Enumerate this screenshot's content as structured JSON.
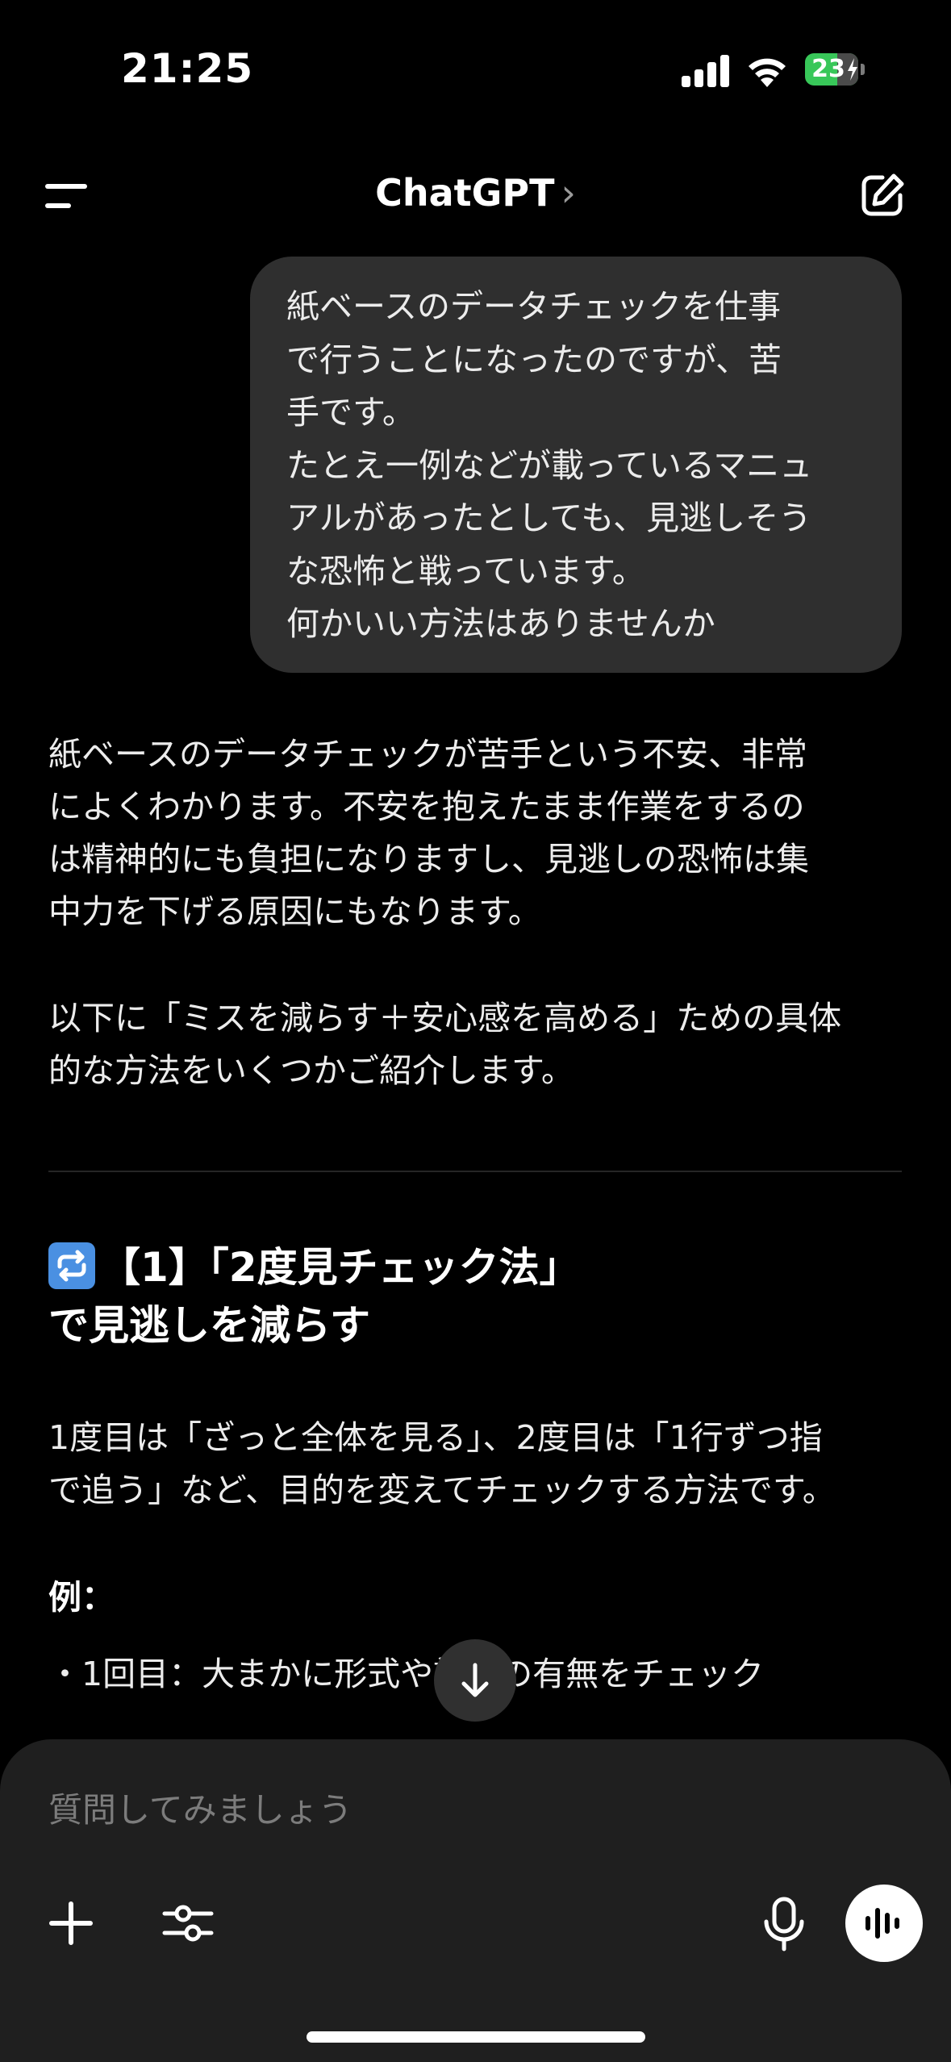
{
  "status_bar": {
    "time": "21:25",
    "battery_percent": "23"
  },
  "header": {
    "title": "ChatGPT",
    "chevron": "›"
  },
  "user_message": "紙ベースのデータチェックを仕事\nで行うことになったのですが、苦\n手です。\nたとえ一例などが載っているマニュ\nアルがあったとしても、見逃しそう\nな恐怖と戦っています。\n何かいい方法はありませんか",
  "assistant": {
    "para1": "紙ベースのデータチェックが苦手という不安、非常\nによくわかります。不安を抱えたまま作業をするの\nは精神的にも負担になりますし、見逃しの恐怖は集\n中力を下げる原因にもなります。",
    "para2": "以下に「ミスを減らす＋安心感を高める」ための具体\n的な方法をいくつかご紹介します。",
    "section_heading": "【1】「2度見チェック法」\nで見逃しを減らす",
    "section_body": "1度目は「ざっと全体を見る」、2度目は「1行ずつ指\nで追う」など、目的を変えてチェックする方法です。",
    "example_label": "例：",
    "example_item": "・1回目：大まかに形式や記載の有無をチェック"
  },
  "composer": {
    "placeholder": "質問してみましょう"
  },
  "icons": {
    "menu": "menu-icon",
    "compose": "compose-icon",
    "repeat": "repeat-icon",
    "scroll_down": "arrow-down-icon",
    "plus": "plus-icon",
    "tools": "sliders-icon",
    "mic": "microphone-icon",
    "voice": "voice-waveform-icon"
  },
  "colors": {
    "background": "#000000",
    "bubble": "#2f2f2f",
    "composer": "#1f1f1f",
    "battery": "#38c759",
    "repeat_icon": "#4a90e2"
  }
}
